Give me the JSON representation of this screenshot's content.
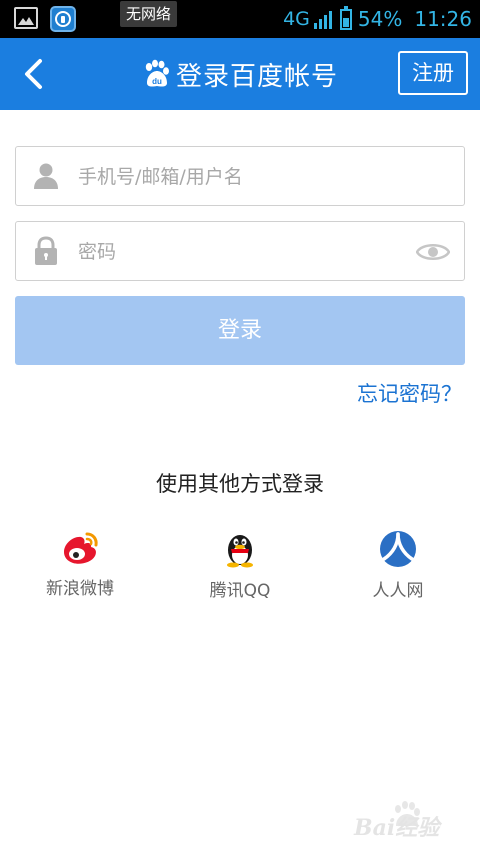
{
  "status_bar": {
    "toast": "无网络",
    "network": "4G",
    "battery": "54%",
    "time": "11:26",
    "icons": [
      "gallery-icon",
      "app-notification-icon",
      "signal-icon",
      "battery-icon"
    ]
  },
  "header": {
    "title": "登录百度帐号",
    "register_label": "注册",
    "logo": "baidu-paw-logo",
    "back_icon": "chevron-left-icon"
  },
  "form": {
    "username_placeholder": "手机号/邮箱/用户名",
    "username_value": "",
    "password_placeholder": "密码",
    "password_value": "",
    "login_label": "登录",
    "forgot_label": "忘记密码？"
  },
  "other_login": {
    "title": "使用其他方式登录",
    "options": [
      {
        "label": "新浪微博",
        "icon": "weibo-icon"
      },
      {
        "label": "腾讯QQ",
        "icon": "qq-penguin-icon"
      },
      {
        "label": "人人网",
        "icon": "renren-icon"
      }
    ]
  },
  "colors": {
    "header_bg": "#1b7ee0",
    "login_button_bg": "#a3c6f2",
    "link": "#1b73d2",
    "status_accent": "#33b5e5"
  },
  "watermark": "Bai经验"
}
